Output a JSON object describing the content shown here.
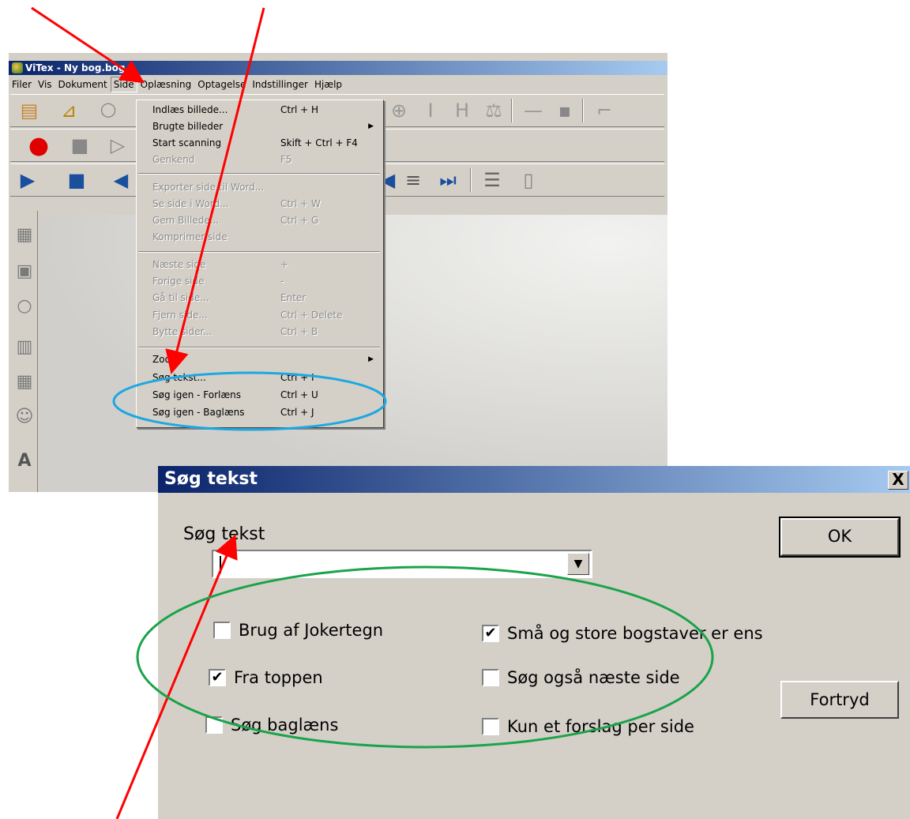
{
  "window": {
    "title": "ViTex - Ny bog.bog",
    "menu": [
      "Filer",
      "Vis",
      "Dokument",
      "Side",
      "Oplæsning",
      "Optagelse",
      "Indstillinger",
      "Hjælp"
    ]
  },
  "side_menu": {
    "items": [
      {
        "label": "Indlæs billede...",
        "shortcut": "Ctrl + H",
        "enabled": true
      },
      {
        "label": "Brugte billeder",
        "shortcut": "",
        "enabled": true,
        "submenu": true
      },
      {
        "label": "Start scanning",
        "shortcut": "Skift + Ctrl + F4",
        "enabled": true
      },
      {
        "label": "Genkend",
        "shortcut": "F5",
        "enabled": false
      },
      {
        "label": "Exporter side til Word...",
        "shortcut": "",
        "enabled": false
      },
      {
        "label": "Se side i Word...",
        "shortcut": "Ctrl + W",
        "enabled": false
      },
      {
        "label": "Gem Billede...",
        "shortcut": "Ctrl + G",
        "enabled": false
      },
      {
        "label": "Komprimer side",
        "shortcut": "",
        "enabled": false
      },
      {
        "label": "Næste side",
        "shortcut": "+",
        "enabled": false
      },
      {
        "label": "Forige side",
        "shortcut": "-",
        "enabled": false
      },
      {
        "label": "Gå til side...",
        "shortcut": "Enter",
        "enabled": false
      },
      {
        "label": "Fjern side...",
        "shortcut": "Ctrl + Delete",
        "enabled": false
      },
      {
        "label": "Bytte sider...",
        "shortcut": "Ctrl + B",
        "enabled": false
      },
      {
        "label": "Zoom",
        "shortcut": "",
        "enabled": true,
        "submenu": true
      },
      {
        "label": "Søg tekst...",
        "shortcut": "Ctrl + I",
        "enabled": true
      },
      {
        "label": "Søg igen - Forlæns",
        "shortcut": "Ctrl + U",
        "enabled": true
      },
      {
        "label": "Søg igen - Baglæns",
        "shortcut": "Ctrl + J",
        "enabled": true
      }
    ]
  },
  "dialog": {
    "title": "Søg tekst",
    "close": "X",
    "search_label": "Søg tekst",
    "search_value": "",
    "ok": "OK",
    "cancel": "Fortryd",
    "options": {
      "jokertegn": {
        "label": "Brug af Jokertegn",
        "checked": false
      },
      "fra_toppen": {
        "label": "Fra toppen",
        "checked": true
      },
      "baglaens": {
        "label": "Søg baglæns",
        "checked": false
      },
      "store_smaa": {
        "label": "Små og store bogstaver er ens",
        "checked": true
      },
      "naeste_side": {
        "label": "Søg også næste side",
        "checked": false
      },
      "kun_et": {
        "label": "Kun et forslag per side",
        "checked": false
      }
    }
  },
  "annotations": {
    "arrow_color": "#ff0000",
    "menu_highlight_color": "#1ea7e1",
    "options_highlight_color": "#1aa34a"
  }
}
